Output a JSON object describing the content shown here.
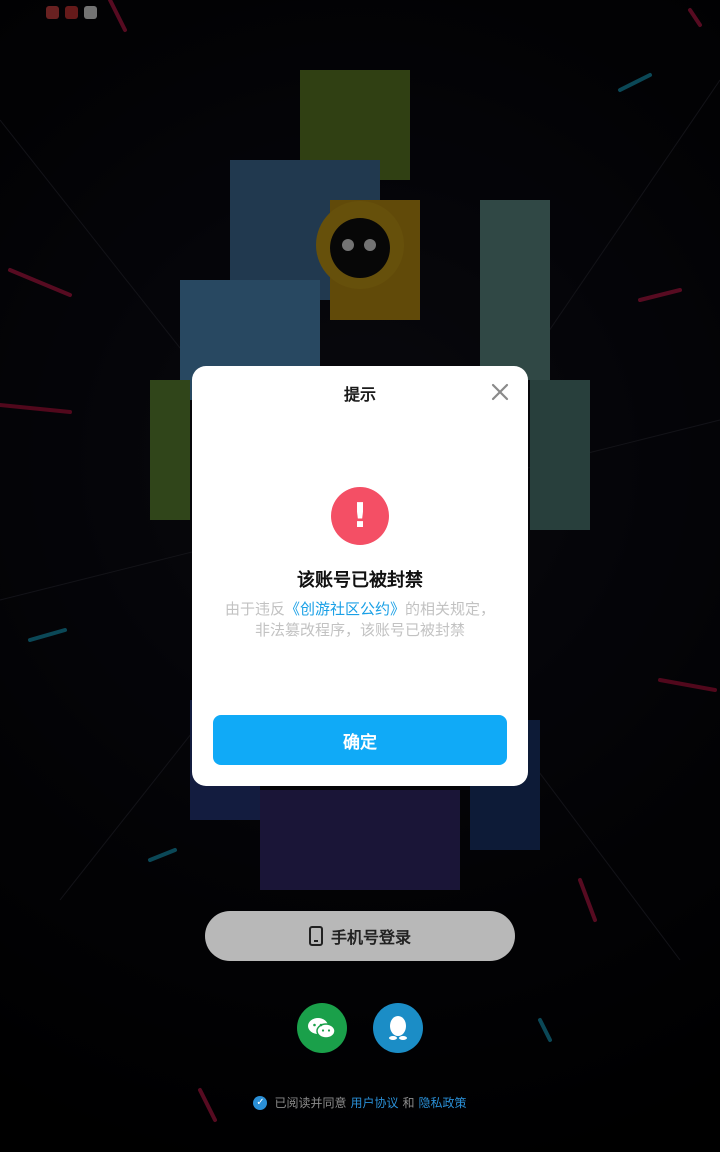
{
  "status_bar": {
    "icons": [
      "red-app-icon",
      "red-app-icon",
      "qq-icon"
    ]
  },
  "login": {
    "phone_login_label": "手机号登录",
    "agreement_prefix": "已阅读并同意",
    "user_agreement": "用户协议",
    "and_text": "和",
    "privacy_policy": "隐私政策",
    "social_icons": [
      "wechat-icon",
      "qq-icon"
    ]
  },
  "dialog": {
    "title": "提示",
    "alert_symbol": "!",
    "heading": "该账号已被封禁",
    "body_prefix": "由于违反",
    "body_link": "《创游社区公约》",
    "body_suffix": "的相关规定，非法篡改程序，该账号已被封禁",
    "confirm_label": "确定"
  },
  "colors": {
    "accent": "#10aaf7",
    "alert": "#f44f65",
    "wechat": "#1aa04a",
    "qq": "#1b8dc6"
  }
}
